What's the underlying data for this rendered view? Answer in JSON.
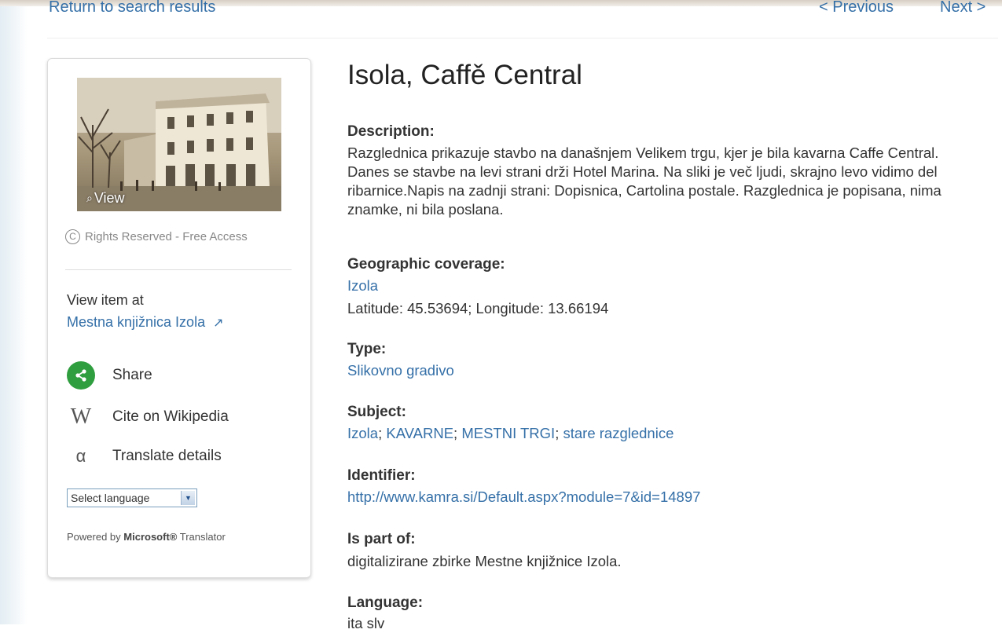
{
  "nav": {
    "back": "Return to search results",
    "previous": "< Previous",
    "next": "Next >"
  },
  "sidebar": {
    "thumbnail_view_label": "View",
    "rights": "Rights Reserved - Free Access",
    "view_item_at_label": "View item at",
    "view_item_at_link": "Mestna knjižnica Izola",
    "actions": {
      "share": "Share",
      "cite": "Cite on Wikipedia",
      "translate": "Translate details"
    },
    "language_select_value": "Select language",
    "powered_by_prefix": "Powered by",
    "powered_by_brand": "Microsoft®",
    "powered_by_suffix": "Translator"
  },
  "item": {
    "title": "Isola, Caffě Central",
    "description_label": "Description:",
    "description": "Razglednica prikazuje stavbo na današnjem Velikem trgu, kjer je bila kavarna Caffe Central. Danes se stavbe na levi strani drži Hotel Marina. Na sliki je več ljudi, skrajno levo vidimo del ribarnice.Napis na zadnji strani: Dopisnica, Cartolina postale. Razglednica je popisana, nima znamke, ni bila poslana.",
    "geo_label": "Geographic coverage:",
    "geo_place": "Izola",
    "geo_coords": "Latitude: 45.53694; Longitude: 13.66194",
    "type_label": "Type:",
    "type_value": "Slikovno gradivo",
    "subject_label": "Subject:",
    "subjects": [
      "Izola",
      "KAVARNE",
      "MESTNI TRGI",
      "stare razglednice"
    ],
    "identifier_label": "Identifier:",
    "identifier": "http://www.kamra.si/Default.aspx?module=7&id=14897",
    "part_of_label": "Is part of:",
    "part_of": "digitalizirane zbirke Mestne knjižnice Izola.",
    "language_label": "Language:",
    "language_value": "ita slv"
  },
  "colors": {
    "link": "#3570a8",
    "share_green": "#2f9e3f"
  }
}
